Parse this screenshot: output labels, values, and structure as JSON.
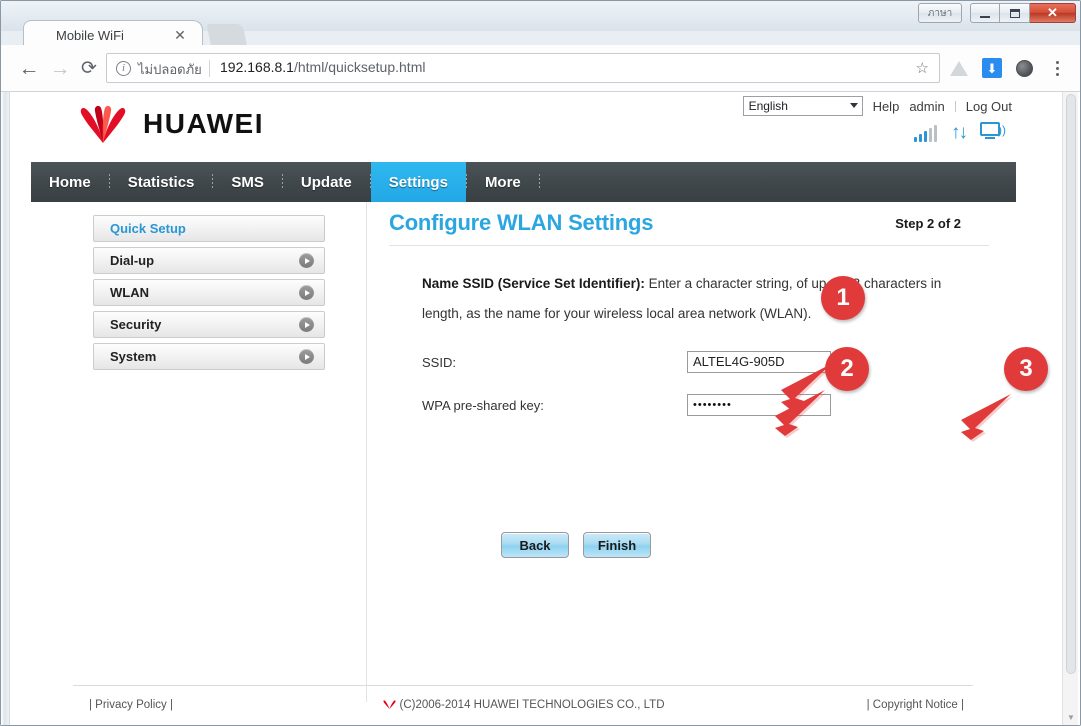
{
  "window": {
    "thai_button": "ภาษา",
    "minimize": "Minimize",
    "maximize": "Maximize",
    "close": "✕"
  },
  "browser": {
    "tab_title": "Mobile WiFi",
    "tab_close": "✕",
    "back": "←",
    "forward": "→",
    "reload": "⟳",
    "info_icon": "i",
    "security_label": "ไม่ปลอดภัย",
    "url_host": "192.168.8.1",
    "url_path": "/html/quicksetup.html",
    "bookmark_star": "☆"
  },
  "header": {
    "brand": "HUAWEI",
    "language": "English",
    "links": [
      "Help",
      "admin",
      "Log Out"
    ],
    "signal_bars_on": 3,
    "signal_bars_total": 5
  },
  "mainnav": {
    "items": [
      {
        "label": "Home",
        "active": false
      },
      {
        "label": "Statistics",
        "active": false
      },
      {
        "label": "SMS",
        "active": false
      },
      {
        "label": "Update",
        "active": false
      },
      {
        "label": "Settings",
        "active": true
      },
      {
        "label": "More",
        "active": false
      }
    ]
  },
  "sidebar": {
    "items": [
      {
        "label": "Quick Setup",
        "active": true,
        "arrow": false
      },
      {
        "label": "Dial-up",
        "active": false,
        "arrow": true
      },
      {
        "label": "WLAN",
        "active": false,
        "arrow": true
      },
      {
        "label": "Security",
        "active": false,
        "arrow": true
      },
      {
        "label": "System",
        "active": false,
        "arrow": true
      }
    ]
  },
  "content": {
    "title": "Configure WLAN Settings",
    "step": "Step 2 of 2",
    "description_bold": "Name SSID (Service Set Identifier):",
    "description_rest": " Enter a character string, of up to 32 characters in length, as the name for your wireless local area network (WLAN).",
    "fields": [
      {
        "label": "SSID:",
        "value": "ALTEL4G-905D",
        "type": "text"
      },
      {
        "label": "WPA pre-shared key:",
        "value": "••••••••",
        "type": "password"
      }
    ],
    "buttons": [
      {
        "label": "Back"
      },
      {
        "label": "Finish"
      }
    ]
  },
  "footer": {
    "left": "| Privacy Policy |",
    "center": "(C)2006-2014 HUAWEI TECHNOLOGIES CO., LTD",
    "right": "| Copyright Notice |"
  },
  "annotations": [
    {
      "number": "1"
    },
    {
      "number": "2"
    },
    {
      "number": "3"
    }
  ],
  "colors": {
    "accent": "#2ba6e0",
    "nav_active": "#23a8e6",
    "brand_red": "#e00000",
    "annotation_red": "#e03a3a"
  }
}
